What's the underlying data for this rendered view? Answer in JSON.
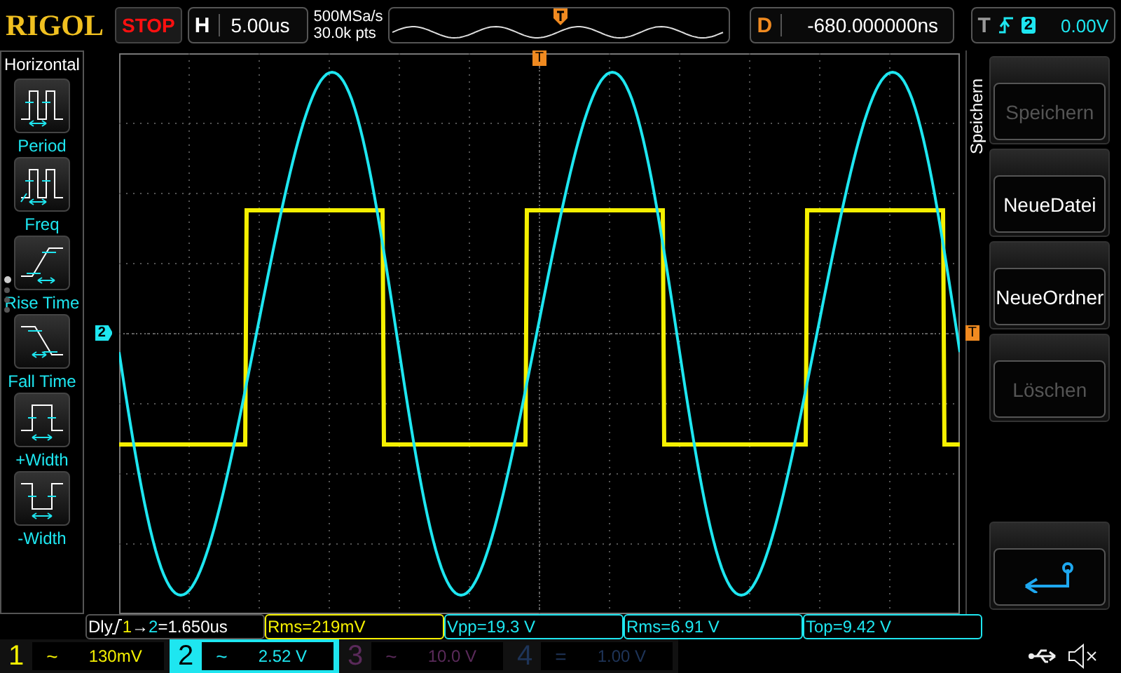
{
  "brand": "RIGOL",
  "run_state": "STOP",
  "horizontal": {
    "label": "H",
    "timebase": "5.00us",
    "sample_rate": "500MSa/s",
    "memory_depth": "30.0k pts"
  },
  "delay": {
    "label": "D",
    "value": "-680.000000ns"
  },
  "trigger": {
    "label": "T",
    "source": "2",
    "level": "0.00V"
  },
  "left_menu": {
    "title": "Horizontal",
    "items": [
      {
        "kind": "period",
        "label": "Period"
      },
      {
        "kind": "freq",
        "label": "Freq"
      },
      {
        "kind": "rise",
        "label": "Rise Time"
      },
      {
        "kind": "fall",
        "label": "Fall Time"
      },
      {
        "kind": "pwidth",
        "label": "+Width"
      },
      {
        "kind": "nwidth",
        "label": "-Width"
      }
    ],
    "pages": [
      {
        "selected": true
      },
      {
        "selected": false
      },
      {
        "selected": false
      },
      {
        "selected": false
      }
    ]
  },
  "markers": {
    "channel_2": "2",
    "trigger_level": "T",
    "trigger_position": "T"
  },
  "right_menu": {
    "title": "Speichern",
    "buttons": [
      {
        "kind": "text",
        "label": "Speichern",
        "disabled": true
      },
      {
        "kind": "text",
        "label": "NeueDatei",
        "disabled": false
      },
      {
        "kind": "text",
        "label": "NeueOrdner",
        "disabled": false
      },
      {
        "kind": "text",
        "label": "Löschen",
        "disabled": true
      },
      {
        "kind": "spacer"
      },
      {
        "kind": "back"
      }
    ]
  },
  "measurements": [
    {
      "kind": "delay",
      "prefix": "Dly",
      "source": "1",
      "arrow": "→",
      "target": "2",
      "value": "=1.650us"
    },
    {
      "kind": "plain",
      "text": "Rms=219mV",
      "color": "#f5f000"
    },
    {
      "kind": "plain",
      "text": "Vpp=19.3 V",
      "color": "#1ee6f0"
    },
    {
      "kind": "plain",
      "text": "Rms=6.91 V",
      "color": "#1ee6f0"
    },
    {
      "kind": "plain",
      "text": "Top=9.42 V",
      "color": "#1ee6f0"
    }
  ],
  "channels": [
    {
      "number": "1",
      "coupling": "~",
      "scale": "130mV",
      "enabled": true,
      "selected": false
    },
    {
      "number": "2",
      "coupling": "~",
      "scale": "2.52 V",
      "enabled": true,
      "selected": true
    },
    {
      "number": "3",
      "coupling": "~",
      "scale": "10.0 V",
      "enabled": false,
      "selected": false
    },
    {
      "number": "4",
      "coupling": "=",
      "scale": "1.00 V",
      "enabled": false,
      "selected": false
    }
  ]
}
